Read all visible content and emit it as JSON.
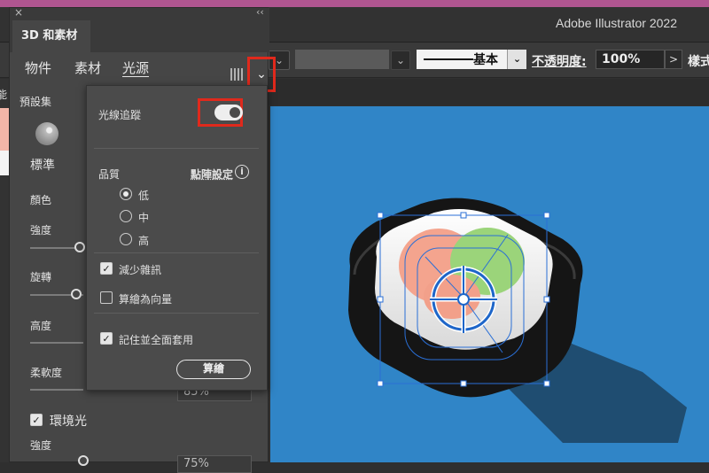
{
  "app": {
    "title": "Adobe Illustrator 2022"
  },
  "controlbar": {
    "stroke_profile": "基本",
    "opacity_label": "不透明度:",
    "opacity_value": "100%",
    "opacity_arrow": ">",
    "style_label": "樣式"
  },
  "panel": {
    "close": "×",
    "collapse": "‹‹",
    "tab_title": "3D 和素材",
    "subtabs": [
      "物件",
      "素材",
      "光源"
    ],
    "active_subtab": "光源",
    "dropdown_chevron": "⌄",
    "preset_label": "預設集",
    "preset_name": "標準",
    "color_label": "顏色",
    "intensity_label": "強度",
    "rotation_label": "旋轉",
    "height_label": "高度",
    "softness_label": "柔軟度",
    "softness_value": "85%",
    "ambient_label": "環境光",
    "ambient_checked": true,
    "ambient_intensity_label": "強度",
    "ambient_intensity_value": "75%",
    "left_clip_label": "能"
  },
  "popover": {
    "raytrace_label": "光線追蹤",
    "raytrace_on": true,
    "quality_label": "品質",
    "render_settings_label": "點陣設定",
    "info_icon": "i",
    "quality_options": [
      {
        "label": "低",
        "selected": true
      },
      {
        "label": "中",
        "selected": false
      },
      {
        "label": "高",
        "selected": false
      }
    ],
    "reduce_noise_label": "減少雜訊",
    "reduce_noise_checked": true,
    "render_as_vector_label": "算繪為向量",
    "render_as_vector_checked": false,
    "remember_label": "記住並全面套用",
    "remember_checked": true,
    "render_button": "算繪"
  },
  "colors": {
    "canvas_blue": "#3085c7",
    "highlight_red": "#e0291c",
    "selection_blue": "#2a6fd6"
  }
}
